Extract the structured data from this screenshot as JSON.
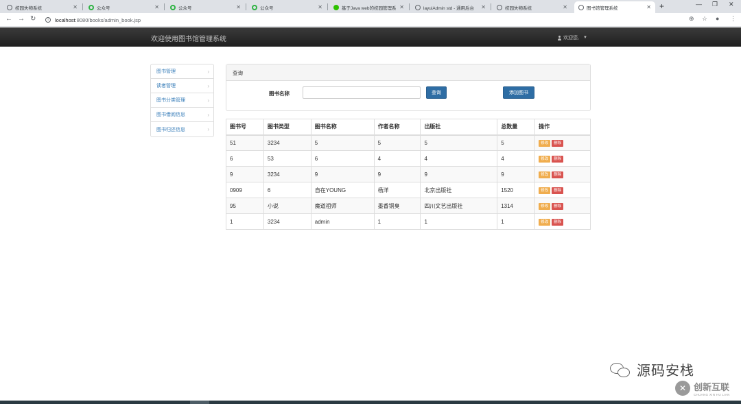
{
  "browser": {
    "tabs": [
      {
        "title": "校园失物系统",
        "icon": "globe-icon",
        "icon_color": "#5f6368",
        "active": false
      },
      {
        "title": "公众号",
        "icon": "green-ring-icon",
        "icon_color": "#2fb344",
        "active": false
      },
      {
        "title": "公众号",
        "icon": "green-ring-icon",
        "icon_color": "#2fb344",
        "active": false
      },
      {
        "title": "公众号",
        "icon": "green-ring-icon",
        "icon_color": "#2fb344",
        "active": false
      },
      {
        "title": "基于Java web的校园管理系",
        "icon": "wechat-icon",
        "icon_color": "#2dc100",
        "active": false
      },
      {
        "title": "layuiAdmin std - 通用后台",
        "icon": "globe-icon",
        "icon_color": "#5f6368",
        "active": false
      },
      {
        "title": "校园失物系统",
        "icon": "globe-icon",
        "icon_color": "#5f6368",
        "active": false
      },
      {
        "title": "图书馆管理系统",
        "icon": "globe-icon",
        "icon_color": "#5f6368",
        "active": true
      }
    ],
    "url_host": "localhost",
    "url_path": ":8080/books/admin_book.jsp"
  },
  "navbar": {
    "brand": "欢迎使用图书馆管理系统",
    "welcome": "欢迎您,"
  },
  "sidebar": {
    "items": [
      {
        "label": "图书管理"
      },
      {
        "label": "读者管理"
      },
      {
        "label": "图书分类管理"
      },
      {
        "label": "图书借阅信息"
      },
      {
        "label": "图书归还信息"
      }
    ]
  },
  "query": {
    "heading": "查询",
    "field_label": "图书名称",
    "field_value": "",
    "search_button": "查询",
    "add_button": "添加图书"
  },
  "table": {
    "headers": [
      "图书号",
      "图书类型",
      "图书名称",
      "作者名称",
      "出版社",
      "总数量",
      "操作"
    ],
    "rows": [
      [
        "51",
        "3234",
        "5",
        "5",
        "5",
        "5"
      ],
      [
        "6",
        "53",
        "6",
        "4",
        "4",
        "4"
      ],
      [
        "9",
        "3234",
        "9",
        "9",
        "9",
        "9"
      ],
      [
        "0909",
        "6",
        "自在YOUNG",
        "杨洋",
        "北京出版社",
        "1520"
      ],
      [
        "95",
        "小说",
        "魔道祖师",
        "墨香铜臭",
        "四川文艺出版社",
        "1314"
      ],
      [
        "1",
        "3234",
        "admin",
        "1",
        "1",
        "1"
      ]
    ],
    "edit_label": "修改",
    "delete_label": "删除"
  },
  "watermarks": {
    "channel": "源码安栈",
    "brand_cn": "创新互联",
    "brand_en": "CHUANG XIN HU LIAN"
  },
  "colors": {
    "navbar_bg": "#222222",
    "primary": "#2e6da4",
    "link": "#337ab7",
    "edit": "#f0ad4e",
    "delete": "#d9534f"
  }
}
